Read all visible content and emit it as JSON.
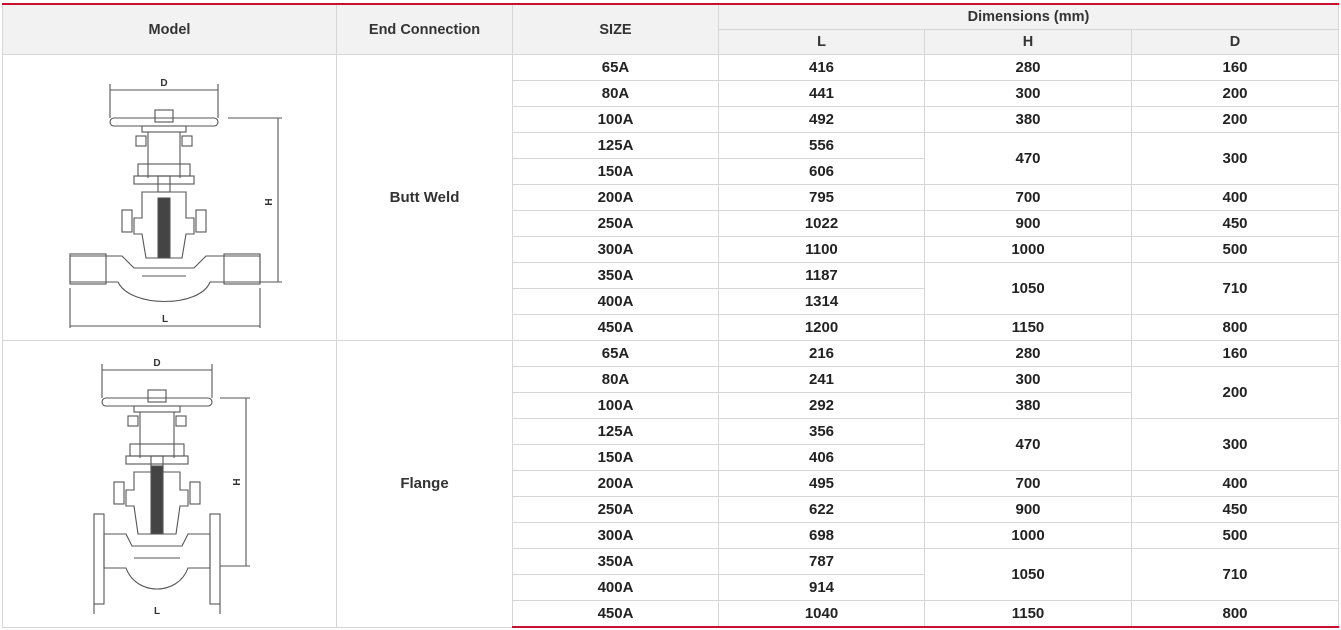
{
  "headers": {
    "model": "Model",
    "end_connection": "End Connection",
    "size": "SIZE",
    "dimensions": "Dimensions (mm)",
    "L": "L",
    "H": "H",
    "D": "D"
  },
  "drawing_labels": {
    "D": "D",
    "H": "H",
    "L": "L"
  },
  "groups": [
    {
      "end_connection": "Butt Weld",
      "rows": [
        {
          "size": "65A",
          "L": "416",
          "H": "280",
          "D": "160"
        },
        {
          "size": "80A",
          "L": "441",
          "H": "300",
          "D": "200"
        },
        {
          "size": "100A",
          "L": "492",
          "H": "380",
          "D": "200"
        },
        {
          "size": "125A",
          "L": "556",
          "H": "470",
          "D": "300"
        },
        {
          "size": "150A",
          "L": "606"
        },
        {
          "size": "200A",
          "L": "795",
          "H": "700",
          "D": "400"
        },
        {
          "size": "250A",
          "L": "1022",
          "H": "900",
          "D": "450"
        },
        {
          "size": "300A",
          "L": "1100",
          "H": "1000",
          "D": "500"
        },
        {
          "size": "350A",
          "L": "1187",
          "H": "1050",
          "D": "710"
        },
        {
          "size": "400A",
          "L": "1314"
        },
        {
          "size": "450A",
          "L": "1200",
          "H": "1150",
          "D": "800"
        }
      ]
    },
    {
      "end_connection": "Flange",
      "rows": [
        {
          "size": "65A",
          "L": "216",
          "H": "280",
          "D": "160"
        },
        {
          "size": "80A",
          "L": "241",
          "H": "300",
          "D": "200"
        },
        {
          "size": "100A",
          "L": "292",
          "H": "380"
        },
        {
          "size": "125A",
          "L": "356",
          "H": "470",
          "D": "300"
        },
        {
          "size": "150A",
          "L": "406"
        },
        {
          "size": "200A",
          "L": "495",
          "H": "700",
          "D": "400"
        },
        {
          "size": "250A",
          "L": "622",
          "H": "900",
          "D": "450"
        },
        {
          "size": "300A",
          "L": "698",
          "H": "1000",
          "D": "500"
        },
        {
          "size": "350A",
          "L": "787",
          "H": "1050",
          "D": "710"
        },
        {
          "size": "400A",
          "L": "914"
        },
        {
          "size": "450A",
          "L": "1040",
          "H": "1150",
          "D": "800"
        }
      ]
    }
  ]
}
